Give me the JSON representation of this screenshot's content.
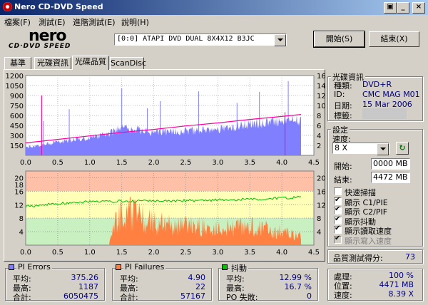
{
  "window": {
    "title": "Nero CD-DVD Speed"
  },
  "menu": [
    "檔案(F)",
    "測試(E)",
    "進階測試(E)",
    "說明(H)"
  ],
  "logo": {
    "main": "nero",
    "sub": "CD·DVD SPEED"
  },
  "drive": {
    "selected": "[0:0]   ATAPI DVD DUAL 8X4X12 B3JC"
  },
  "buttons": {
    "start": "開始(S)",
    "end": "結束(X)"
  },
  "tabs": [
    "基準",
    "光碟資訊",
    "光碟品質",
    "ScanDisc"
  ],
  "disc_info": {
    "title": "光碟資訊",
    "type_label": "種類:",
    "type": "DVD+R",
    "id_label": "ID:",
    "id": "CMC MAG M01",
    "date_label": "日期:",
    "date": "15 Mar 2006",
    "label_label": "標籤:"
  },
  "settings": {
    "title": "設定",
    "speed_label": "速度:",
    "speed": "8 X",
    "start_label": "開始:",
    "start": "0000 MB",
    "end_label": "結束:",
    "end": "4472 MB",
    "checkboxes": [
      "快速掃描",
      "顯示 C1/PIE",
      "顯示 C2/PIF",
      "顯示抖動",
      "顯示讀取速度",
      "顯示寫入速度"
    ],
    "checked": [
      false,
      true,
      true,
      true,
      true,
      true
    ],
    "disabled": [
      false,
      false,
      false,
      false,
      false,
      true
    ]
  },
  "score": {
    "label": "品質測試得分:",
    "value": "73"
  },
  "progress": {
    "process_label": "處理:",
    "process": "100 %",
    "position_label": "位置:",
    "position": "4471 MB",
    "speed_label": "速度:",
    "speed": "8.39 X"
  },
  "pi_errors": {
    "title": "PI Errors",
    "avg_label": "平均:",
    "avg": "375.26",
    "max_label": "最高:",
    "max": "1187",
    "total_label": "合計:",
    "total": "6050475",
    "color": "#8080ff"
  },
  "pi_failures": {
    "title": "PI Failures",
    "avg_label": "平均:",
    "avg": "4.90",
    "max_label": "最高:",
    "max": "22",
    "total_label": "合計:",
    "total": "57167",
    "color": "#ff8040"
  },
  "jitter": {
    "title": "抖動",
    "avg_label": "平均:",
    "avg": "12.99 %",
    "max_label": "最高:",
    "max": "16.7 %",
    "po_label": "PO 失敗:",
    "po": "0",
    "color": "#00c000"
  },
  "chart_data": [
    {
      "type": "area",
      "yticks_left": [
        "1200",
        "1050",
        "900",
        "750",
        "600",
        "450",
        "300",
        "150"
      ],
      "yticks_right": [
        "16",
        "14",
        "12",
        "10",
        "8",
        "6",
        "4",
        "2"
      ],
      "xticks": [
        "0.0",
        "0.5",
        "1.0",
        "1.5",
        "2.0",
        "2.5",
        "3.0",
        "3.5",
        "4.0",
        "4.5"
      ],
      "xlim": [
        0,
        4.5
      ],
      "ylim": [
        0,
        1200
      ],
      "y2lim": [
        0,
        16
      ],
      "series": [
        {
          "name": "PI Errors",
          "color": "#8080ff",
          "x": [
            0,
            0.5,
            1.0,
            1.3,
            1.5,
            2.0,
            2.5,
            3.0,
            3.5,
            4.0,
            4.3
          ],
          "values": [
            120,
            200,
            270,
            320,
            420,
            340,
            360,
            390,
            470,
            520,
            540
          ]
        },
        {
          "name": "Read speed",
          "color": "#ff00a0",
          "x": [
            0,
            0.5,
            1.0,
            1.5,
            2.0,
            2.5,
            3.0,
            3.5,
            4.0,
            4.3
          ],
          "values": [
            2.5,
            3.2,
            3.9,
            4.6,
            5.2,
            5.9,
            6.5,
            7.2,
            7.8,
            8.2
          ]
        }
      ]
    },
    {
      "type": "area",
      "yticks_left": [
        "20",
        "18",
        "16",
        "12",
        "8",
        "4"
      ],
      "yticks_right": [
        "20",
        "16",
        "12",
        "8",
        "4"
      ],
      "xticks": [
        "0.0",
        "0.5",
        "1.0",
        "1.5",
        "2.0",
        "2.5",
        "3.0",
        "3.5",
        "4.0",
        "4.5"
      ],
      "xlim": [
        0,
        4.5
      ],
      "ylim": [
        0,
        22
      ],
      "series": [
        {
          "name": "PI Failures",
          "color": "#ff8040",
          "x": [
            0,
            1.3,
            1.4,
            1.6,
            2.0,
            2.5,
            3.0,
            3.5,
            4.0,
            4.3
          ],
          "values": [
            0,
            0,
            8,
            10,
            7,
            6,
            5,
            6,
            4,
            3
          ]
        },
        {
          "name": "Jitter",
          "color": "#00c000",
          "x": [
            0,
            0.5,
            1.0,
            1.5,
            2.0,
            2.5,
            3.0,
            3.5,
            4.0,
            4.3
          ],
          "values": [
            11.5,
            12.3,
            12.9,
            13.0,
            13.1,
            13.2,
            13.4,
            13.6,
            14.0,
            14.2
          ]
        }
      ]
    }
  ]
}
